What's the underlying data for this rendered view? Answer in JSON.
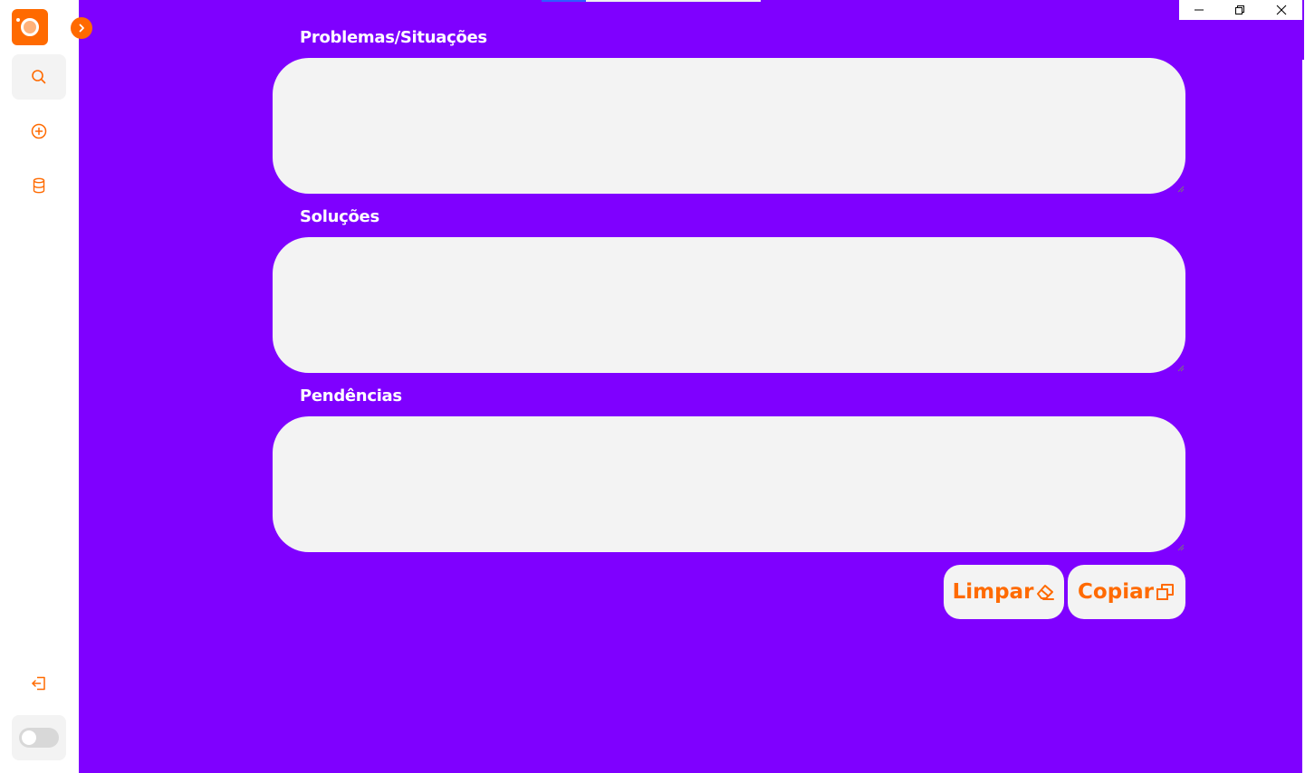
{
  "app": {
    "brand_color": "#ff6a00",
    "background_color": "#7f00ff",
    "field_color": "#f3f3f3"
  },
  "sidebar": {
    "logo_icon": "app-logo-icon",
    "expand_icon": "chevron-right-icon",
    "items": [
      {
        "name": "search",
        "icon": "search-icon",
        "active": true
      },
      {
        "name": "add",
        "icon": "plus-circle-icon",
        "active": false
      },
      {
        "name": "database",
        "icon": "database-icon",
        "active": false
      }
    ],
    "logout_icon": "logout-icon",
    "theme_toggle": {
      "on": false
    }
  },
  "window_controls": {
    "minimize": "minimize-icon",
    "restore": "restore-icon",
    "close": "close-icon"
  },
  "form": {
    "fields": [
      {
        "label": "Problemas/Situações",
        "value": ""
      },
      {
        "label": "Soluções",
        "value": ""
      },
      {
        "label": "Pendências",
        "value": ""
      }
    ],
    "buttons": {
      "clear_label": "Limpar",
      "copy_label": "Copiar"
    }
  }
}
